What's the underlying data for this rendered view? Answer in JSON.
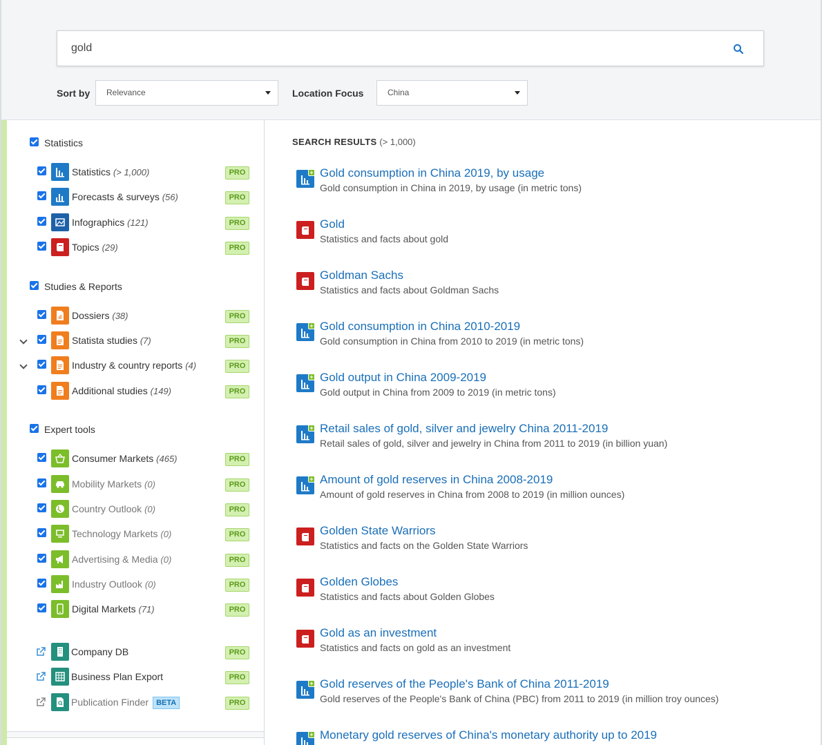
{
  "search": {
    "value": "gold"
  },
  "sort": {
    "label": "Sort by",
    "value": "Relevance"
  },
  "location": {
    "label": "Location Focus",
    "value": "China"
  },
  "sidebar": {
    "groups": [
      {
        "title": "Statistics",
        "items": [
          {
            "label": "Statistics",
            "count": "(> 1,000)",
            "pro": "PRO"
          },
          {
            "label": "Forecasts & surveys",
            "count": "(56)",
            "pro": "PRO"
          },
          {
            "label": "Infographics",
            "count": "(121)",
            "pro": "PRO"
          },
          {
            "label": "Topics",
            "count": "(29)",
            "pro": "PRO"
          }
        ]
      },
      {
        "title": "Studies & Reports",
        "items": [
          {
            "label": "Dossiers",
            "count": "(38)",
            "pro": "PRO"
          },
          {
            "label": "Statista studies",
            "count": "(7)",
            "pro": "PRO"
          },
          {
            "label": "Industry & country reports",
            "count": "(4)",
            "pro": "PRO"
          },
          {
            "label": "Additional studies",
            "count": "(149)",
            "pro": "PRO"
          }
        ]
      },
      {
        "title": "Expert tools",
        "items": [
          {
            "label": "Consumer Markets",
            "count": "(465)",
            "pro": "PRO"
          },
          {
            "label": "Mobility Markets",
            "count": "(0)",
            "pro": "PRO"
          },
          {
            "label": "Country Outlook",
            "count": "(0)",
            "pro": "PRO"
          },
          {
            "label": "Technology Markets",
            "count": "(0)",
            "pro": "PRO"
          },
          {
            "label": "Advertising & Media",
            "count": "(0)",
            "pro": "PRO"
          },
          {
            "label": "Industry Outlook",
            "count": "(0)",
            "pro": "PRO"
          },
          {
            "label": "Digital Markets",
            "count": "(71)",
            "pro": "PRO"
          }
        ]
      }
    ],
    "links": [
      {
        "label": "Company DB",
        "pro": "PRO"
      },
      {
        "label": "Business Plan Export",
        "pro": "PRO"
      },
      {
        "label": "Publication Finder",
        "badge": "BETA",
        "pro": "PRO"
      }
    ]
  },
  "results": {
    "header": "SEARCH RESULTS",
    "count": "(> 1,000)",
    "items": [
      {
        "title": "Gold consumption in China 2019, by usage",
        "desc": "Gold consumption in China in 2019, by usage (in metric tons)",
        "icon": "statistic-icon"
      },
      {
        "title": "Gold",
        "desc": "Statistics and facts about gold",
        "icon": "topic-icon"
      },
      {
        "title": "Goldman Sachs",
        "desc": "Statistics and facts about Goldman Sachs",
        "icon": "topic-icon"
      },
      {
        "title": "Gold consumption in China 2010-2019",
        "desc": "Gold consumption in China from 2010 to 2019 (in metric tons)",
        "icon": "statistic-icon"
      },
      {
        "title": "Gold output in China 2009-2019",
        "desc": "Gold output in China from 2009 to 2019 (in metric tons)",
        "icon": "statistic-icon"
      },
      {
        "title": "Retail sales of gold, silver and jewelry China 2011-2019",
        "desc": "Retail sales of gold, silver and jewelry in China from 2011 to 2019 (in billion yuan)",
        "icon": "statistic-icon"
      },
      {
        "title": "Amount of gold reserves in China 2008-2019",
        "desc": "Amount of gold reserves in China from 2008 to 2019 (in million ounces)",
        "icon": "statistic-icon"
      },
      {
        "title": "Golden State Warriors",
        "desc": "Statistics and facts on the Golden State Warriors",
        "icon": "topic-icon"
      },
      {
        "title": "Golden Globes",
        "desc": "Statistics and facts about Golden Globes",
        "icon": "topic-icon"
      },
      {
        "title": "Gold as an investment",
        "desc": "Statistics and facts on gold as an investment",
        "icon": "topic-icon"
      },
      {
        "title": "Gold reserves of the People's Bank of China 2011-2019",
        "desc": "Gold reserves of the People's Bank of China (PBC) from 2011 to 2019 (in million troy ounces)",
        "icon": "statistic-icon"
      },
      {
        "title": "Monetary gold reserves of China's monetary authority up to 2019",
        "desc": "",
        "icon": "statistic-icon"
      }
    ]
  },
  "colors": {
    "accent": "#1a6fb8",
    "pro_bg": "#d3f0b0",
    "stat_icon": "#1e7ac7",
    "topic_icon": "#cc1f1f",
    "study_icon": "#f07e1e",
    "tool_icon": "#7cbd2a",
    "link_icon": "#24907e"
  }
}
